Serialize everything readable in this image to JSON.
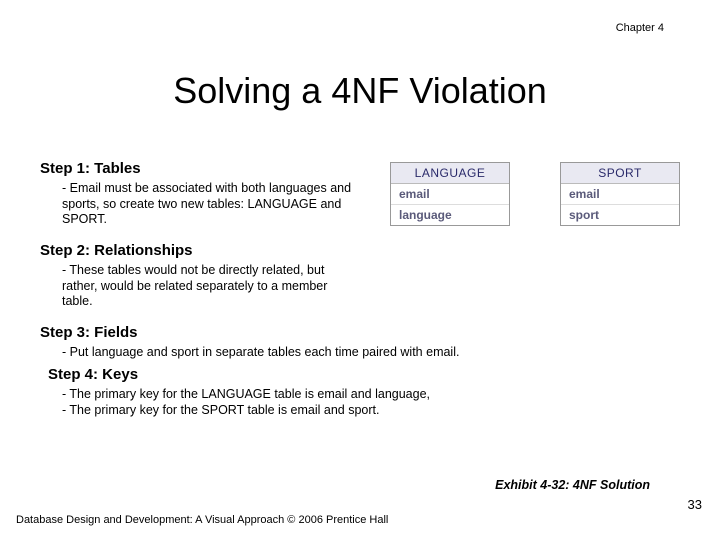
{
  "chapter": "Chapter 4",
  "title": "Solving a 4NF Violation",
  "steps": {
    "s1": {
      "heading": "Step 1: Tables",
      "body": "- Email must be associated with both languages and sports, so create two new tables: LANGUAGE and SPORT."
    },
    "s2": {
      "heading": "Step 2: Relationships",
      "body": "- These tables would not be directly related, but rather, would be related separately to a member table."
    },
    "s3": {
      "heading": "Step 3: Fields",
      "body": "- Put language and sport in separate tables each time paired with email."
    },
    "s4": {
      "heading": "Step 4: Keys",
      "line1": "- The primary key for the LANGUAGE table is email and language,",
      "line2": "- The primary key for the SPORT table is email and sport."
    }
  },
  "tables": {
    "language": {
      "header": "LANGUAGE",
      "rows": [
        "email",
        "language"
      ]
    },
    "sport": {
      "header": "SPORT",
      "rows": [
        "email",
        "sport"
      ]
    }
  },
  "exhibit": "Exhibit 4-32: 4NF Solution",
  "footer_left": "Database Design and Development: A Visual Approach   © 2006 Prentice Hall",
  "page_number": "33"
}
